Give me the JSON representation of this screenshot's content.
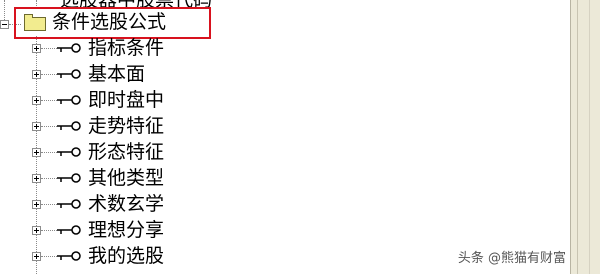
{
  "tree": {
    "partial_top_label": "选股器中股票代码",
    "root": {
      "label": "条件选股公式",
      "children": [
        {
          "label": "指标条件"
        },
        {
          "label": "基本面"
        },
        {
          "label": "即时盘中"
        },
        {
          "label": "走势特征"
        },
        {
          "label": "形态特征"
        },
        {
          "label": "其他类型"
        },
        {
          "label": "术数玄学"
        },
        {
          "label": "理想分享"
        },
        {
          "label": "我的选股"
        }
      ]
    }
  },
  "watermark": "头条 @熊猫有财富",
  "colors": {
    "highlight": "#d8121e",
    "folder": "#f2ec8f",
    "tree_line": "#8a8a8a",
    "scrollbar": "#ece9d8"
  },
  "icons": {
    "root": "folder-icon",
    "child": "key-icon",
    "expander": "plus-box"
  }
}
